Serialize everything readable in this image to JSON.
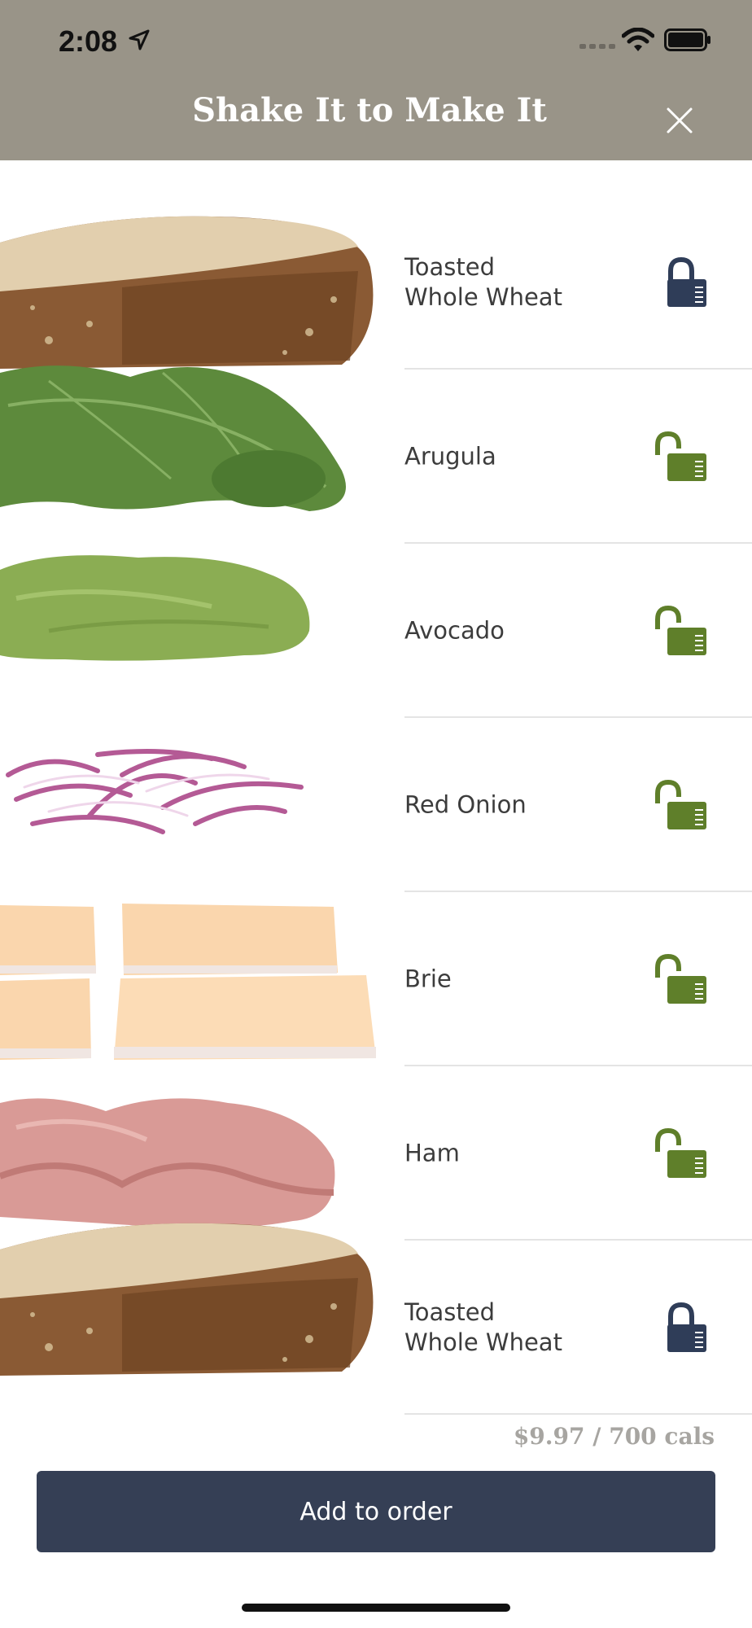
{
  "status_bar": {
    "time": "2:08"
  },
  "header": {
    "title": "Shake It to Make It"
  },
  "ingredients": [
    {
      "label": "Toasted\nWhole Wheat",
      "locked": true
    },
    {
      "label": "Arugula",
      "locked": false
    },
    {
      "label": "Avocado",
      "locked": false
    },
    {
      "label": "Red Onion",
      "locked": false
    },
    {
      "label": "Brie",
      "locked": false
    },
    {
      "label": "Ham",
      "locked": false
    },
    {
      "label": "Toasted\nWhole Wheat",
      "locked": true
    }
  ],
  "summary": {
    "price_cals": "$9.97 / 700 cals"
  },
  "actions": {
    "add_label": "Add to order"
  },
  "colors": {
    "header": "#999488",
    "locked": "#2f3d58",
    "unlocked": "#5f7f2a",
    "button": "#353f55"
  }
}
